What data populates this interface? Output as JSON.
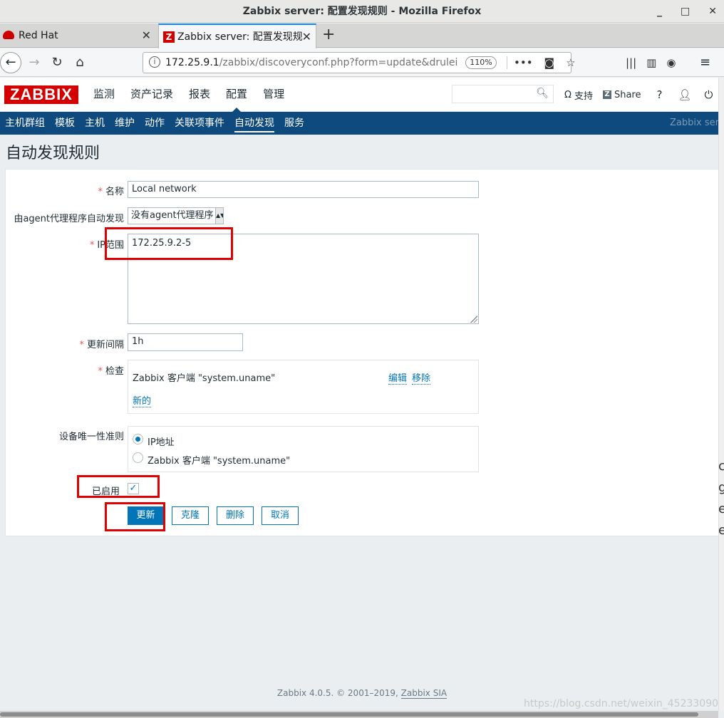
{
  "window": {
    "title": "Zabbix server: 配置发现规则 - Mozilla Firefox"
  },
  "tabs": [
    {
      "label": "Red Hat"
    },
    {
      "label": "Zabbix server: 配置发现规"
    }
  ],
  "urlbar": {
    "url_host": "172.25.9.1",
    "url_path": "/zabbix/discoveryconf.php?form=update&druleid",
    "zoom": "110%"
  },
  "zabbix": {
    "logo": "ZABBIX",
    "top_menu": [
      "监测",
      "资产记录",
      "报表",
      "配置",
      "管理"
    ],
    "support": "支持",
    "share": "Share",
    "help": "?",
    "sub_menu": [
      "主机群组",
      "模板",
      "主机",
      "维护",
      "动作",
      "关联项事件",
      "自动发现",
      "服务"
    ],
    "server_label": "Zabbix server"
  },
  "page": {
    "title": "自动发现规则"
  },
  "form": {
    "name_label": "名称",
    "name_value": "Local network",
    "proxy_label": "由agent代理程序自动发现",
    "proxy_value": "没有agent代理程序",
    "ip_label": "IP范围",
    "ip_value": "172.25.9.2-5",
    "interval_label": "更新间隔",
    "interval_value": "1h",
    "checks_label": "检查",
    "check_item": "Zabbix 客户端 \"system.uname\"",
    "check_edit": "编辑",
    "check_remove": "移除",
    "check_new": "新的",
    "uniqueness_label": "设备唯一性准则",
    "uniq_opt1": "IP地址",
    "uniq_opt2": "Zabbix 客户端 \"system.uname\"",
    "enabled_label": "已启用",
    "btn_update": "更新",
    "btn_clone": "克隆",
    "btn_delete": "删除",
    "btn_cancel": "取消"
  },
  "footer": {
    "text": "Zabbix 4.0.5. © 2001–2019,",
    "link": "Zabbix SIA"
  },
  "watermark": "https://blog.csdn.net/weixin_45233090"
}
